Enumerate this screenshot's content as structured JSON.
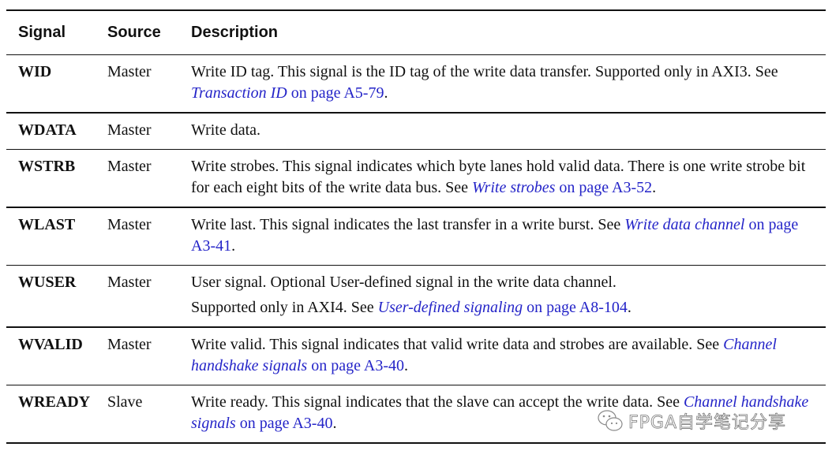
{
  "table": {
    "headers": {
      "signal": "Signal",
      "source": "Source",
      "description": "Description"
    },
    "rows": [
      {
        "signal": "WID",
        "source": "Master",
        "desc_pre": "Write ID tag. This signal is the ID tag of the write data transfer. Supported only in AXI3. See ",
        "link_italic": "Transaction ID",
        "link_page": " on page A5-79",
        "desc_post": "."
      },
      {
        "signal": "WDATA",
        "source": "Master",
        "desc_pre": "Write data.",
        "link_italic": "",
        "link_page": "",
        "desc_post": ""
      },
      {
        "signal": "WSTRB",
        "source": "Master",
        "desc_pre": "Write strobes. This signal indicates which byte lanes hold valid data. There is one write strobe bit for each eight bits of the write data bus. See ",
        "link_italic": "Write strobes",
        "link_page": " on page A3-52",
        "desc_post": "."
      },
      {
        "signal": "WLAST",
        "source": "Master",
        "desc_pre": "Write last. This signal indicates the last transfer in a write burst. See ",
        "link_italic": "Write data channel",
        "link_page": " on page A3-41",
        "desc_post": "."
      },
      {
        "signal": "WUSER",
        "source": "Master",
        "desc_line1": "User signal. Optional User-defined signal in the write data channel.",
        "desc_pre": "Supported only in AXI4. See ",
        "link_italic": "User-defined signaling",
        "link_page": " on page A8-104",
        "desc_post": "."
      },
      {
        "signal": "WVALID",
        "source": "Master",
        "desc_pre": "Write valid. This signal indicates that valid write data and strobes are available. See ",
        "link_italic": "Channel handshake signals",
        "link_page": " on page A3-40",
        "desc_post": "."
      },
      {
        "signal": "WREADY",
        "source": "Slave",
        "desc_pre": "Write ready. This signal indicates that the slave can accept the write data. See ",
        "link_italic": "Channel handshake signals",
        "link_page": " on page A3-40",
        "desc_post": "."
      }
    ]
  },
  "watermark": {
    "icon": "wechat-icon",
    "text": "FPGA自学笔记分享"
  }
}
